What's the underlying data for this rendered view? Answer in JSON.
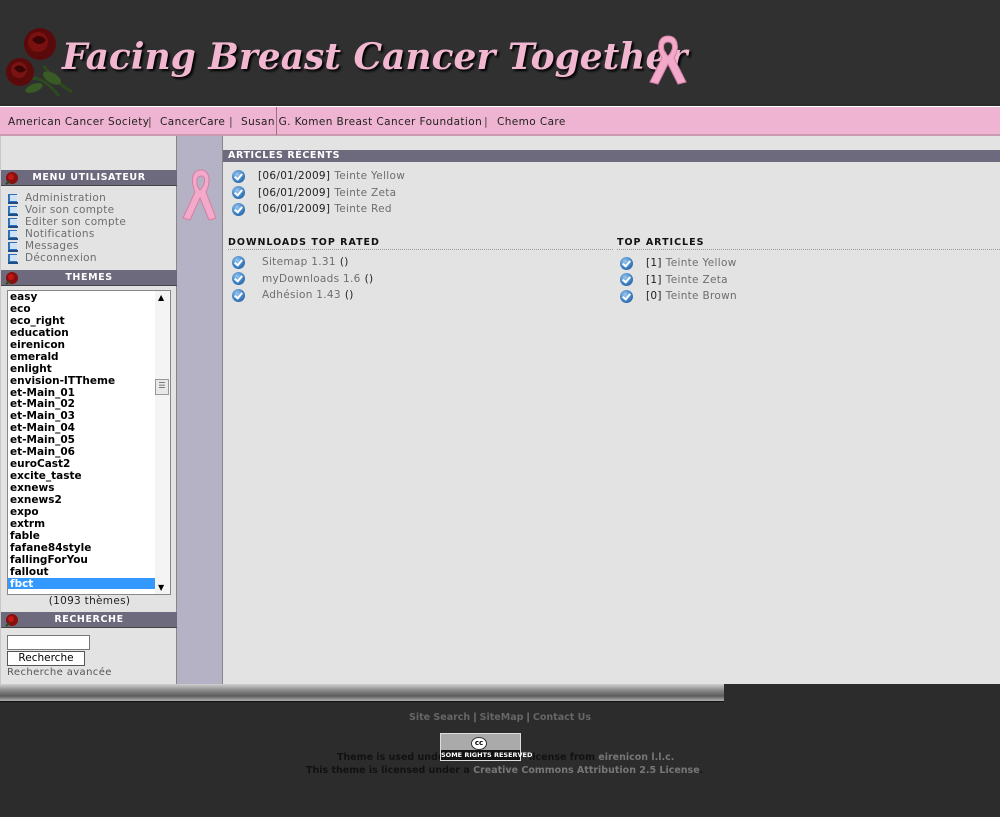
{
  "header": {
    "title": "Facing Breast Cancer Together"
  },
  "links": [
    {
      "label": "American Cancer Society"
    },
    {
      "label": "CancerCare"
    },
    {
      "label": "Susan G. Komen Breast Cancer Foundation"
    },
    {
      "label": "Chemo Care"
    }
  ],
  "link_separator": "|",
  "user_menu": {
    "title": "MENU UTILISATEUR",
    "items": [
      {
        "label": "Administration"
      },
      {
        "label": "Voir son compte"
      },
      {
        "label": "Editer son compte"
      },
      {
        "label": "Notifications"
      },
      {
        "label": "Messages"
      },
      {
        "label": "Déconnexion"
      }
    ]
  },
  "themes": {
    "title": "THEMES",
    "options": [
      "easy",
      "eco",
      "eco_right",
      "education",
      "eirenicon",
      "emerald",
      "enlight",
      "envision-ITTheme",
      "et-Main_01",
      "et-Main_02",
      "et-Main_03",
      "et-Main_04",
      "et-Main_05",
      "et-Main_06",
      "euroCast2",
      "excite_taste",
      "exnews",
      "exnews2",
      "expo",
      "extrm",
      "fable",
      "fafane84style",
      "fallingForYou",
      "fallout",
      "fbct"
    ],
    "selected": "fbct",
    "count_text": "(1093 thèmes)"
  },
  "search": {
    "title": "RECHERCHE",
    "input_value": "",
    "button_label": "Recherche",
    "advanced_label": "Recherche avancée"
  },
  "recent_articles": {
    "title": "ARTICLES RÉCENTS",
    "items": [
      {
        "date": "[06/01/2009]",
        "title": "Teinte Yellow"
      },
      {
        "date": "[06/01/2009]",
        "title": "Teinte Zeta"
      },
      {
        "date": "[06/01/2009]",
        "title": "Teinte Red"
      }
    ]
  },
  "downloads_top_rated": {
    "title": "DOWNLOADS TOP RATED",
    "items": [
      {
        "title": "Sitemap 1.31",
        "suffix": "()"
      },
      {
        "title": "myDownloads 1.6",
        "suffix": "()"
      },
      {
        "title": "Adhésion 1.43",
        "suffix": "()"
      }
    ]
  },
  "top_articles": {
    "title": "TOP ARTICLES",
    "items": [
      {
        "count": "[1]",
        "title": "Teinte Yellow"
      },
      {
        "count": "[1]",
        "title": "Teinte Zeta"
      },
      {
        "count": "[0]",
        "title": "Teinte Brown"
      }
    ]
  },
  "footer": {
    "links": [
      {
        "label": "Site Search"
      },
      {
        "label": "SiteMap"
      },
      {
        "label": "Contact Us"
      }
    ],
    "badge_text": "SOME RIGHTS RESERVED",
    "line1_prefix": "Theme is used under",
    "line1_middle": "license from",
    "line1_company": "eirenicon l.l.c.",
    "line2_prefix": "This theme is licensed under a",
    "line2_license": "Creative Commons Attribution 2.5 License",
    "line2_suffix": "."
  },
  "colors": {
    "header_bg": "#303030",
    "pink": "#efb4d1",
    "block_title_bg": "#6c6a7c",
    "content_bg": "#e3e3e3",
    "ribbon_col": "#b4b2c4",
    "selected": "#3399ff"
  }
}
